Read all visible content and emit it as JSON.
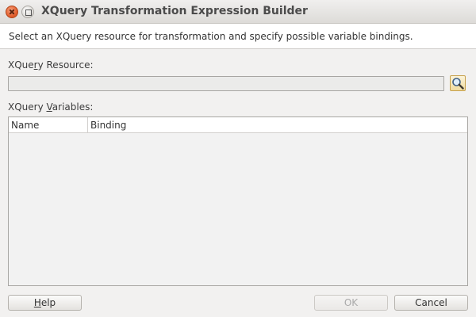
{
  "window": {
    "title": "XQuery Transformation Expression Builder"
  },
  "header": {
    "description": "Select an XQuery resource for transformation and specify possible variable bindings."
  },
  "resource": {
    "label_pre": "XQue",
    "label_mnemonic": "r",
    "label_post": "y Resource:",
    "value": ""
  },
  "variables": {
    "label_pre": "XQuery ",
    "label_mnemonic": "V",
    "label_post": "ariables:",
    "columns": [
      "Name",
      "Binding"
    ],
    "rows": []
  },
  "buttons": {
    "help_mnemonic": "H",
    "help_rest": "elp",
    "ok": "OK",
    "cancel": "Cancel"
  },
  "icons": {
    "browse": "magnifier-search-icon",
    "close": "close-icon",
    "maximize": "maximize-icon"
  },
  "colors": {
    "close_button": "#e3602f",
    "browse_button": "#f0dca0"
  }
}
